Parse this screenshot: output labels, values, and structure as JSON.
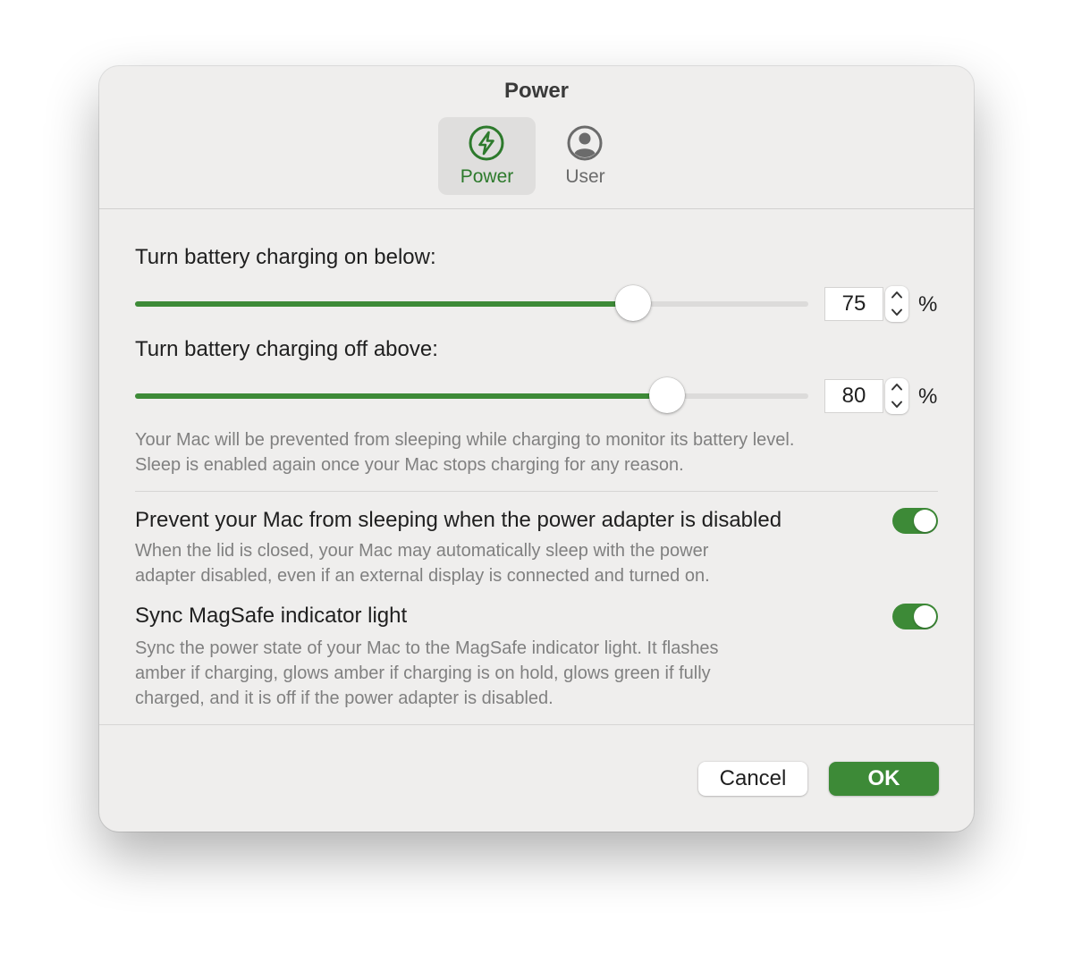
{
  "window": {
    "title": "Power"
  },
  "tabs": [
    {
      "label": "Power",
      "icon": "bolt-circle-icon",
      "active": true
    },
    {
      "label": "User",
      "icon": "person-circle-icon",
      "active": false
    }
  ],
  "charge_on": {
    "label": "Turn battery charging on below:",
    "value": "75",
    "unit": "%",
    "slider_fraction": 0.74
  },
  "charge_off": {
    "label": "Turn battery charging off above:",
    "value": "80",
    "unit": "%",
    "slider_fraction": 0.79
  },
  "sleep_note": {
    "line1": "Your Mac will be prevented from sleeping while charging to monitor its battery level.",
    "line2": "Sleep is enabled again once your Mac stops charging for any reason."
  },
  "prevent_sleep": {
    "label": "Prevent your Mac from sleeping when the power adapter is disabled",
    "line1": "When the lid is closed, your Mac may automatically sleep with the power",
    "line2": "adapter disabled, even if an external display is connected and turned on.",
    "enabled": true
  },
  "magsafe": {
    "label": "Sync MagSafe indicator light",
    "line1": "Sync the power state of your Mac to the MagSafe indicator light. It flashes",
    "line2": "amber if charging, glows amber if charging is on hold, glows green if fully",
    "line3": "charged, and it is off if the power adapter is disabled.",
    "enabled": true
  },
  "buttons": {
    "cancel": "Cancel",
    "ok": "OK"
  },
  "colors": {
    "accent": "#3d8a37",
    "window_bg": "#efeeed"
  }
}
